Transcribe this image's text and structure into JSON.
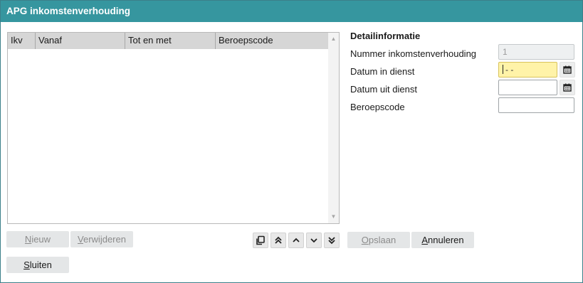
{
  "window": {
    "title": "APG inkomstenverhouding"
  },
  "grid": {
    "columns": [
      "Ikv",
      "Vanaf",
      "Tot en met",
      "Beroepscode"
    ],
    "rows": []
  },
  "grid_buttons": {
    "new_prefix": "",
    "new_mnemonic": "N",
    "new_rest": "ieuw",
    "delete_prefix": "",
    "delete_mnemonic": "V",
    "delete_rest": "erwijderen"
  },
  "nav_icons": [
    "copy-icon",
    "move-to-top-icon",
    "move-up-icon",
    "move-down-icon",
    "move-to-bottom-icon"
  ],
  "actions": {
    "save_prefix": "",
    "save_mnemonic": "O",
    "save_rest": "pslaan",
    "cancel_prefix": "",
    "cancel_mnemonic": "A",
    "cancel_rest": "nnuleren",
    "close_prefix": "",
    "close_mnemonic": "S",
    "close_rest": "luiten"
  },
  "detail": {
    "title": "Detailinformatie",
    "nummer_label": "Nummer inkomstenverhouding",
    "nummer_value": "1",
    "datum_in_label": "Datum in dienst",
    "datum_in_value": "- -",
    "datum_uit_label": "Datum uit dienst",
    "datum_uit_value": "",
    "beroepscode_label": "Beroepscode",
    "beroepscode_value": ""
  },
  "colors": {
    "titlebar": "#36969f",
    "focused_field": "#fff3a8"
  }
}
